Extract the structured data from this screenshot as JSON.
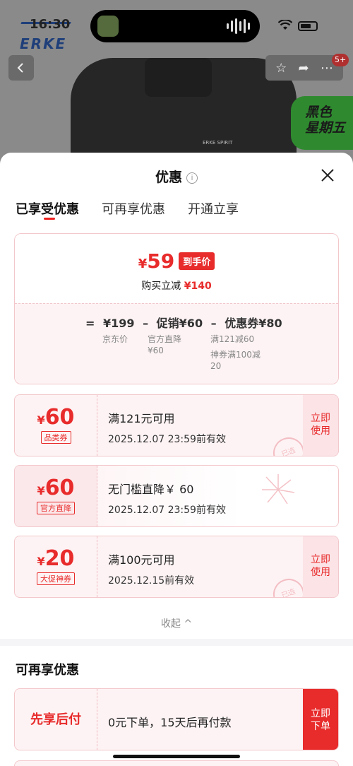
{
  "status_bar": {
    "time": "16:30",
    "brand_logo": "ERKE"
  },
  "product_page": {
    "jacket_logo": "ERKE SPIRIT",
    "badge_count": "5+",
    "promo_banner": "黑色星期五"
  },
  "sheet": {
    "title": "优惠",
    "info_icon": "ⓘ",
    "close_icon": "✕",
    "tabs": [
      {
        "label": "已享受优惠",
        "active": true
      },
      {
        "label": "可再享优惠",
        "active": false
      },
      {
        "label": "开通立享",
        "active": false
      }
    ],
    "summary": {
      "final_price_symbol": "¥",
      "final_price": "59",
      "price_tag": "到手价",
      "reduce_label": "购买立减",
      "reduce_amount": "¥140",
      "equation": {
        "eq": "=",
        "original": "¥199",
        "minus1": "–",
        "promo": "促销¥60",
        "minus2": "–",
        "coupon": "优惠券¥80"
      },
      "original_caption": "京东价",
      "promo_caption_1": "官方直降",
      "promo_caption_2": "¥60",
      "coupon_caption_1": "满121减60",
      "coupon_caption_2": "神券满100减",
      "coupon_caption_3": "20"
    },
    "coupons": [
      {
        "symbol": "¥",
        "amount": "60",
        "label": "品类券",
        "condition": "满121元可用",
        "expiry": "2025.12.07 23:59前有效",
        "action": "立即使用",
        "stamp": "已选"
      },
      {
        "symbol": "¥",
        "amount": "60",
        "label": "官方直降",
        "condition": "无门槛直降￥ 60",
        "expiry": "2025.12.07 23:59前有效"
      },
      {
        "symbol": "¥",
        "amount": "20",
        "label": "大促神券",
        "condition": "满100元可用",
        "expiry": "2025.12.15前有效",
        "action": "立即使用",
        "stamp": "已选"
      }
    ],
    "collapse_label": "收起 ^",
    "more_section_title": "可再享优惠",
    "bnpl": {
      "name": "先享后付",
      "desc": "0元下单，15天后再付款",
      "action": "立即下单"
    }
  },
  "colors": {
    "accent": "#e82b2b",
    "card_bg": "#fdf3f4",
    "card_border": "#f3c8cc"
  }
}
